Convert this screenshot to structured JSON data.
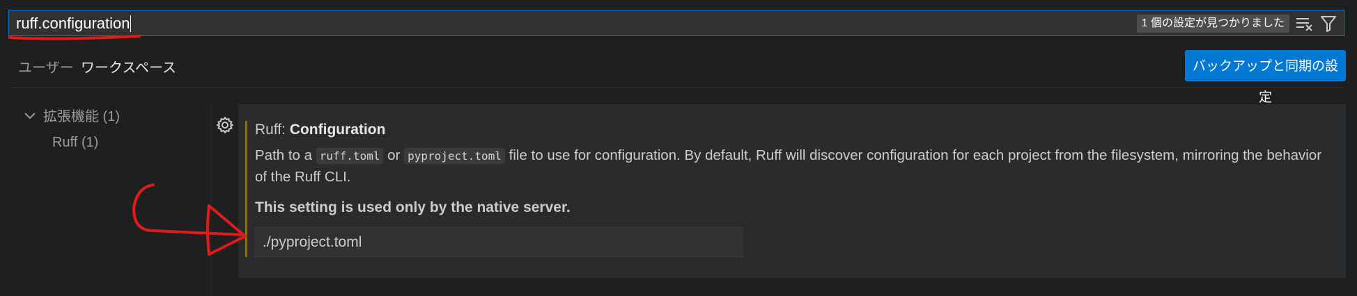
{
  "search": {
    "value": "ruff.configuration",
    "results_badge": "1 個の設定が見つかりました",
    "clear_icon": "clear-filter-icon",
    "filter_icon": "filter-icon"
  },
  "tabs": [
    {
      "label": "ユーザー",
      "active": false
    },
    {
      "label": "ワークスペース",
      "active": true
    }
  ],
  "sync_button": "バックアップと同期の設定",
  "tree": {
    "group": "拡張機能 (1)",
    "item": "Ruff (1)"
  },
  "setting": {
    "category": "Ruff: ",
    "title": "Configuration",
    "desc_1": "Path to a ",
    "code_1": "ruff.toml",
    "desc_2": " or ",
    "code_2": "pyproject.toml",
    "desc_3": " file to use for configuration. By default, Ruff will discover configuration for each project from the filesystem, mirroring the behavior of the Ruff CLI.",
    "note": "This setting is used only by the native server.",
    "value": "./pyproject.toml"
  },
  "colors": {
    "accent": "#0078d4",
    "annotation": "#e01b1b",
    "modified": "#8a6d1f"
  }
}
